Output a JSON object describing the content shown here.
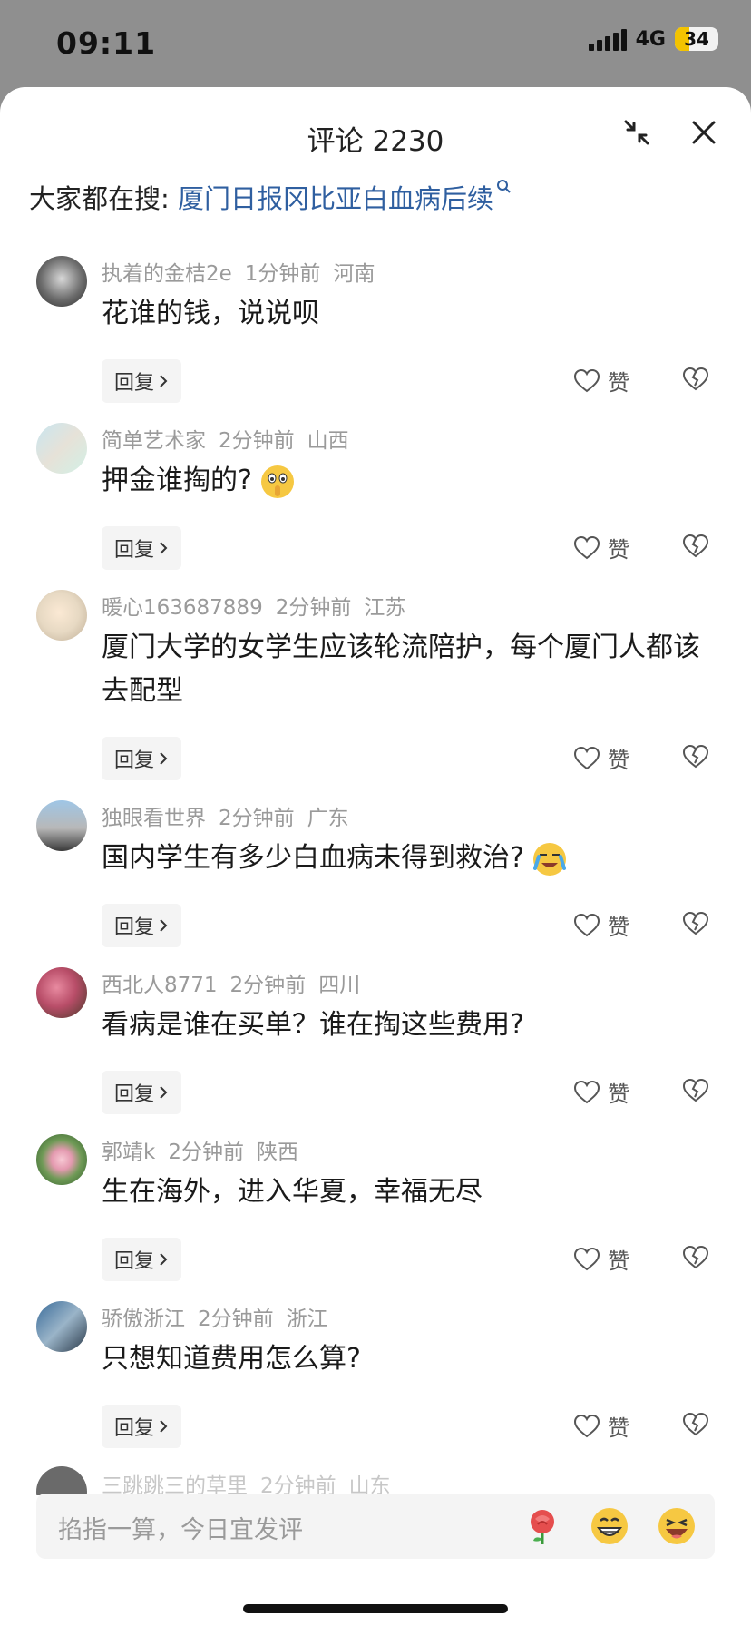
{
  "status_bar": {
    "time": "09:11",
    "network": "4G",
    "battery_level": "34"
  },
  "header": {
    "title": "评论 2230"
  },
  "search_hint": {
    "prefix": "大家都在搜: ",
    "link": "厦门日报冈比亚白血病后续"
  },
  "labels": {
    "reply": "回复",
    "like": "赞"
  },
  "comments": [
    {
      "user": "执着的金桔2e",
      "time": "1分钟前",
      "location": "河南",
      "text": "花谁的钱，说说呗"
    },
    {
      "user": "简单艺术家",
      "time": "2分钟前",
      "location": "山西",
      "text": "押金谁掏的?"
    },
    {
      "user": "暖心163687889",
      "time": "2分钟前",
      "location": "江苏",
      "text": "厦门大学的女学生应该轮流陪护，每个厦门人都该去配型"
    },
    {
      "user": "独眼看世界",
      "time": "2分钟前",
      "location": "广东",
      "text": "国内学生有多少白血病未得到救治?"
    },
    {
      "user": "西北人8771",
      "time": "2分钟前",
      "location": "四川",
      "text": "看病是谁在买单？谁在掏这些费用?"
    },
    {
      "user": "郭靖k",
      "time": "2分钟前",
      "location": "陕西",
      "text": "生在海外，进入华夏，幸福无尽"
    },
    {
      "user": "骄傲浙江",
      "time": "2分钟前",
      "location": "浙江",
      "text": "只想知道费用怎么算?"
    },
    {
      "user": "三跳跳三的草里",
      "time": "2分钟前",
      "location": "山东"
    }
  ],
  "input": {
    "placeholder": "掐指一算，今日宜发评"
  },
  "icons": {
    "collapse": "collapse-icon",
    "close": "close-icon",
    "search": "search-icon",
    "heart": "heart-icon",
    "broken_heart": "broken-heart-icon",
    "emojis": [
      "rose-emoji",
      "grin-emoji",
      "laugh-emoji"
    ]
  },
  "colors": {
    "link": "#2f5fa0",
    "meta": "#9a9a9a",
    "battery": "#f3c300"
  }
}
